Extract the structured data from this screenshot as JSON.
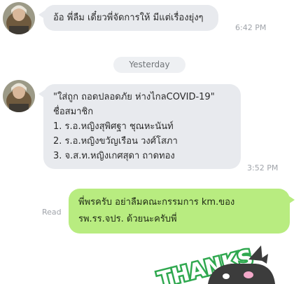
{
  "messages": [
    {
      "text": "อ้อ พี่ลืม เดี๋ยวพี่จัดการให้ มีแต่เรื่องยุ่งๆ",
      "time": "6:42 PM"
    }
  ],
  "date_separator": "Yesterday",
  "announcement": {
    "lines": [
      "\"ใส่ถูก ถอดปลอดภัย ห่างไกลCOVID-19\"",
      "ชื่อสมาชิก",
      "1. ร.อ.หญิงสุพิศฐา ชุณหะนันท์",
      "2. ร.อ.หญิงขวัญเรือน วงศ์โสภา",
      "3. จ.ส.ท.หญิงเกศสุดา ถาดทอง"
    ],
    "time": "3:52 PM"
  },
  "reply": {
    "lines": [
      "พี่พรครับ อย่าลืมคณะกรรมการ km.ของ",
      "รพ.รร.จปร. ด้วยนะครับพี่"
    ],
    "status": "Read"
  },
  "sticker": {
    "text": "THANKS",
    "accent": "#2fa84f",
    "character": "#3c3c3c"
  }
}
